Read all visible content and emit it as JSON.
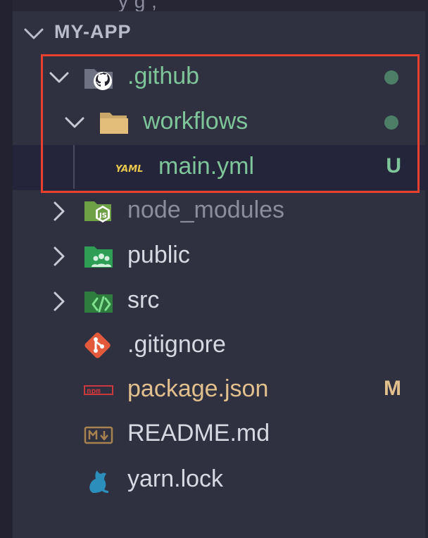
{
  "explorer": {
    "top_partial_text": "y g  ,",
    "section_title": "MY-APP",
    "items": [
      {
        "label": ".github",
        "kind": "folder",
        "icon": "github-folder-icon",
        "expanded": true,
        "status_dot": true,
        "color": "#7ec699"
      },
      {
        "label": "workflows",
        "kind": "folder",
        "icon": "folder-open-icon",
        "expanded": true,
        "status_dot": true,
        "color": "#7ec699"
      },
      {
        "label": "main.yml",
        "kind": "file",
        "icon": "yaml-file-icon",
        "badge": "U",
        "color": "#7ec699",
        "active": true
      },
      {
        "label": "node_modules",
        "kind": "folder",
        "icon": "nodejs-folder-icon",
        "expanded": false,
        "color": "#8b8d9c"
      },
      {
        "label": "public",
        "kind": "folder",
        "icon": "public-folder-icon",
        "expanded": false,
        "color": "#d6d8e2"
      },
      {
        "label": "src",
        "kind": "folder",
        "icon": "src-folder-icon",
        "expanded": false,
        "color": "#d6d8e2"
      },
      {
        "label": ".gitignore",
        "kind": "file",
        "icon": "git-icon",
        "color": "#d6d8e2"
      },
      {
        "label": "package.json",
        "kind": "file",
        "icon": "npm-icon",
        "badge": "M",
        "color": "#e2c08d"
      },
      {
        "label": "README.md",
        "kind": "file",
        "icon": "markdown-icon",
        "color": "#d6d8e2"
      },
      {
        "label": "yarn.lock",
        "kind": "file",
        "icon": "yarn-icon",
        "color": "#d6d8e2"
      }
    ]
  },
  "colors": {
    "untracked": "#7ec699",
    "modified": "#e2c08d",
    "ignored": "#8b8d9c",
    "highlight_border": "#e8402f",
    "status_dot": "#4d7e68"
  }
}
